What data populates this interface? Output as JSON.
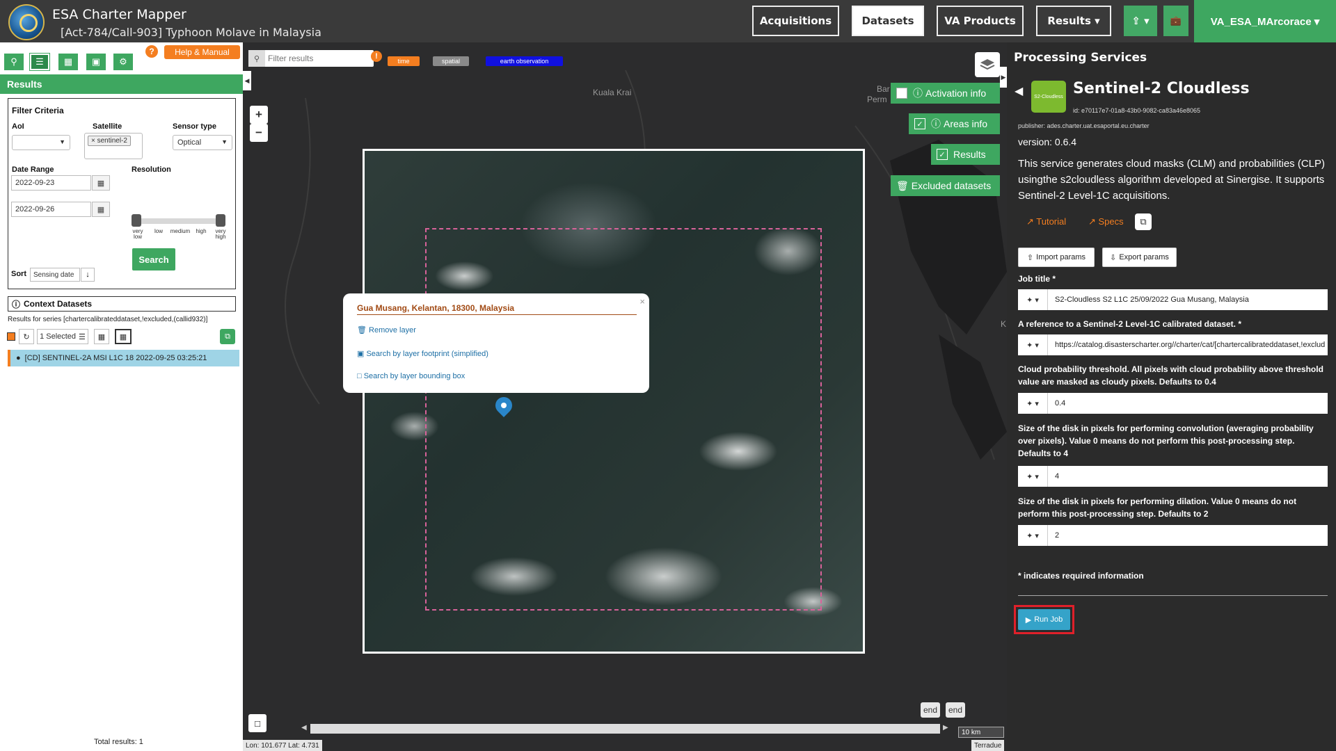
{
  "header": {
    "app_title": "ESA Charter Mapper",
    "activation_title": "[Act-784/Call-903] Typhoon Molave in Malaysia",
    "nav": {
      "acquisitions": "Acquisitions",
      "datasets": "Datasets",
      "va_products": "VA Products",
      "results": "Results ▾",
      "upload": "⇪ ▾",
      "briefcase": "💼"
    },
    "user": "VA_ESA_MArcorace ▾"
  },
  "left": {
    "help": "Help & Manual",
    "help_q": "?",
    "results_title": "Results",
    "filter_title": "Filter Criteria",
    "aoi_label": "AoI",
    "aoi_value": "",
    "satellite_label": "Satellite",
    "satellite_tag": "× sentinel-2",
    "sensor_label": "Sensor type",
    "sensor_value": "Optical",
    "date_label": "Date Range",
    "date_from": "2022-09-23",
    "date_to": "2022-09-26",
    "resolution_label": "Resolution",
    "resolution_levels": [
      "very low",
      "low",
      "medium",
      "high",
      "very high"
    ],
    "search": "Search",
    "sort_label": "Sort",
    "sort_value": "Sensing date",
    "context_title": "Context Datasets",
    "series_text": "Results for series [chartercalibrateddataset,!excluded,(callid932)]",
    "selected": "1 Selected",
    "result_item": "[CD] SENTINEL-2A MSI L1C 18 2022-09-25 03:25:21",
    "total": "Total results: 1"
  },
  "map": {
    "filter_placeholder": "Filter results",
    "chips": [
      {
        "label": "time",
        "color": "#f47e20"
      },
      {
        "label": "spatial",
        "color": "#8a8a8a"
      },
      {
        "label": "earth observation",
        "color": "#1010e0"
      }
    ],
    "places": {
      "kuala_krai": "Kuala Krai",
      "bar": "Bar",
      "perm": "Perm",
      "k": "K"
    },
    "popup": {
      "title": "Gua Musang, Kelantan, 18300, Malaysia",
      "remove": "Remove layer",
      "search_footprint": "Search by layer footprint (simplified)",
      "search_bbox": "Search by layer bounding box"
    },
    "toggles": {
      "activation": "Activation info",
      "areas": "Areas info",
      "results": "Results",
      "excluded": "Excluded datasets"
    },
    "end1": "end",
    "end2": "end",
    "scale": "10 km",
    "coords": "Lon: 101.677 Lat: 4.731",
    "attribution": "Terradue"
  },
  "right": {
    "panel_title": "Processing Services",
    "service_name": "Sentinel-2 Cloudless",
    "service_icon_text": "S2-Cloudless",
    "service_id": "id: e70117e7-01a8-43b0-9082-ca83a46e8065",
    "publisher": "publisher: ades.charter.uat.esaportal.eu.charter",
    "version": "version: 0.6.4",
    "description": "This service generates cloud masks (CLM) and probabilities (CLP) usingthe s2cloudless algorithm developed at Sinergise. It supports Sentinel-2 Level-1C acquisitions.",
    "tutorial": "Tutorial",
    "specs": "Specs",
    "import_params": "Import params",
    "export_params": "Export params",
    "fields": [
      {
        "label": "Job title *",
        "value": "S2-Cloudless S2 L1C 25/09/2022 Gua Musang, Malaysia"
      },
      {
        "label": "A reference to a Sentinel-2 Level-1C calibrated dataset. *",
        "value": "https://catalog.disasterscharter.org//charter/cat/[chartercalibrateddataset,!exclud"
      },
      {
        "label": "Cloud probability threshold. All pixels with cloud probability above threshold value are masked as cloudy pixels. Defaults to 0.4",
        "value": "0.4"
      },
      {
        "label": "Size of the disk in pixels for performing convolution (averaging probability over pixels). Value 0 means do not perform this post-processing step. Defaults to 4",
        "value": "4"
      },
      {
        "label": "Size of the disk in pixels for performing dilation. Value 0 means do not perform this post-processing step. Defaults to 2",
        "value": "2"
      }
    ],
    "required_note": "* indicates required information",
    "run_job": "Run Job"
  }
}
